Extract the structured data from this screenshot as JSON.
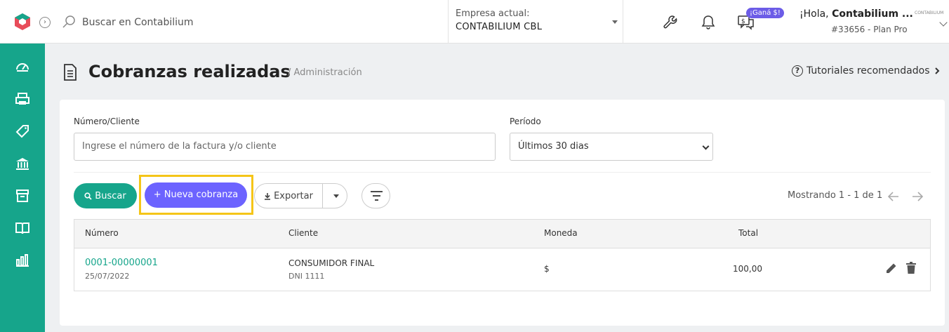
{
  "topbar": {
    "search_placeholder": "Buscar en Contabilium",
    "company_label": "Empresa actual:",
    "company_name": "CONTABILIUM CBL",
    "promo_badge": "¡Ganá $!",
    "greeting_prefix": "¡Hola, ",
    "greeting_name": "Contabilium ...",
    "plan": "#33656 - Plan Pro",
    "brand_mini": "CONTABILIUM"
  },
  "sidebar": {
    "items": [
      "dashboard-icon",
      "printer-icon",
      "tag-icon",
      "bank-icon",
      "box-icon",
      "book-icon",
      "chart-icon"
    ]
  },
  "page": {
    "title": "Cobranzas realizadas",
    "breadcrumb": "/ Administración",
    "tutorials": "Tutoriales recomendados"
  },
  "filters": {
    "numero_label": "Número/Cliente",
    "numero_placeholder": "Ingrese el número de la factura y/o cliente",
    "periodo_label": "Período",
    "periodo_value": "Últimos 30 dias"
  },
  "actions": {
    "buscar": "Buscar",
    "nueva": "+ Nueva cobranza",
    "exportar": "Exportar",
    "showing": "Mostrando 1 - 1 de 1"
  },
  "table": {
    "headers": [
      "Número",
      "Cliente",
      "Moneda",
      "Total"
    ],
    "rows": [
      {
        "numero": "0001-00000001",
        "fecha": "25/07/2022",
        "cliente": "CONSUMIDOR FINAL",
        "documento": "DNI 1111",
        "moneda": "$",
        "total": "100,00"
      }
    ]
  },
  "colors": {
    "brand_green": "#16a58b",
    "accent_purple": "#6c63ff",
    "highlight_yellow": "#f5c518"
  }
}
